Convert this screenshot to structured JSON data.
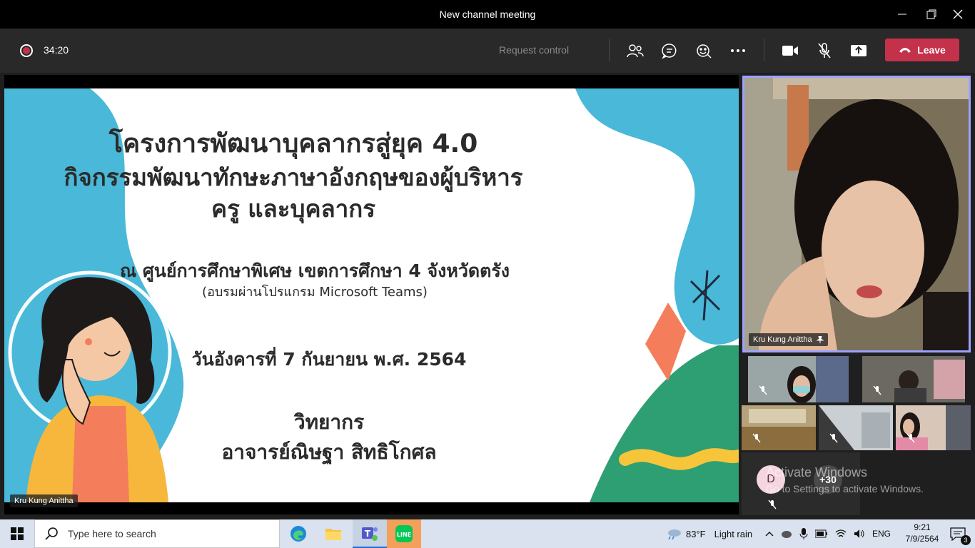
{
  "window": {
    "title": "New channel meeting"
  },
  "toolbar": {
    "timer": "34:20",
    "request_control": "Request control",
    "leave_label": "Leave",
    "accent": "#c4314b",
    "icons": [
      "people-icon",
      "chat-icon",
      "reactions-icon",
      "more-icon",
      "camera-icon",
      "mic-off-icon",
      "share-icon"
    ]
  },
  "slide": {
    "title1": "โครงการพัฒนาบุคลากรสู่ยุค 4.0",
    "title2": "กิจกรรมพัฒนาทักษะภาษาอังกฤษของผู้บริหาร",
    "title3": "ครู และบุคลากร",
    "venue": "ณ ศูนย์การศึกษาพิเศษ เขตการศึกษา 4 จังหวัดตรัง",
    "platform": "(อบรมผ่านโปรแกรม Microsoft Teams)",
    "date": "วันอังคารที่ 7 กันยายน พ.ศ. 2564",
    "speaker_label": "วิทยากร",
    "speaker_name": "อาจารย์ณิษฐา สิทธิโกศล"
  },
  "presenter": {
    "name": "Kru Kung Anittha"
  },
  "pinned": {
    "name": "Kru Kung Anittha",
    "pin_icon": "pin-icon"
  },
  "overflow": {
    "avatar_initial": "D",
    "more_count": "+30"
  },
  "watermark": {
    "line1": "Activate Windows",
    "line2": "Go to Settings to activate Windows."
  },
  "taskbar": {
    "search_placeholder": "Type here to search",
    "temperature": "83°F",
    "weather": "Light rain",
    "language": "ENG",
    "time": "9:21",
    "date": "7/9/2564",
    "notification_count": "3"
  }
}
